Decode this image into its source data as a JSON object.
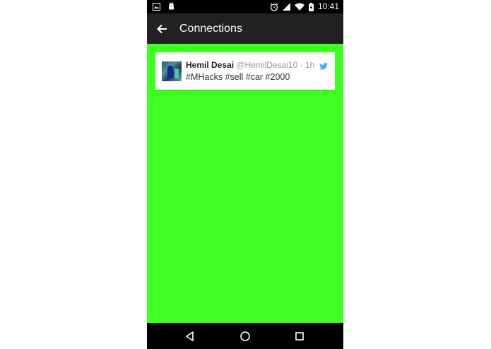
{
  "status_bar": {
    "time": "10:41",
    "icons_left": [
      "gallery-notification-icon",
      "android-debug-icon"
    ],
    "icons_right": [
      "alarm-icon",
      "signal-icon",
      "wifi-icon",
      "battery-charging-icon"
    ]
  },
  "app_bar": {
    "title": "Connections",
    "back_icon": "arrow-left-icon"
  },
  "tweet": {
    "name": "Hemil Desai",
    "handle": "@HemilDesai10",
    "separator": "·",
    "time": "1h",
    "text": "#MHacks #sell #car #2000",
    "source_icon": "twitter-bird-icon"
  },
  "nav_bar": {
    "buttons": [
      "back-triangle-icon",
      "home-circle-icon",
      "recents-square-icon"
    ]
  },
  "colors": {
    "background": "#3fff22",
    "app_bar": "#212121",
    "twitter_blue": "#55acee"
  }
}
